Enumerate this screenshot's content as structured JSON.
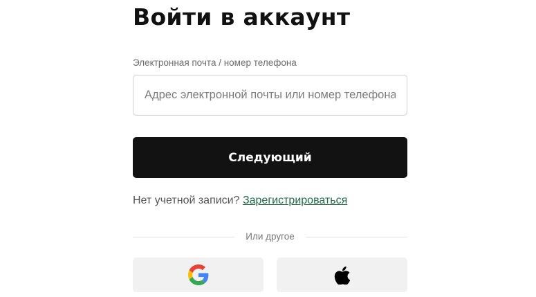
{
  "title": "Войти в аккаунт",
  "email_field": {
    "label": "Электронная почта / номер телефона",
    "placeholder": "Адрес электронной почты или номер телефона",
    "value": ""
  },
  "next_button": {
    "label": "Следующий"
  },
  "signup": {
    "prompt": "Нет учетной записи?",
    "link_label": "Зарегистрироваться",
    "link_color": "#1e6b44"
  },
  "divider": {
    "text": "Или другое"
  },
  "social_buttons": [
    {
      "provider": "google",
      "icon": "google-icon"
    },
    {
      "provider": "apple",
      "icon": "apple-icon"
    }
  ],
  "colors": {
    "primary_button": "#121212",
    "social_button_bg": "#f1f1f1"
  }
}
